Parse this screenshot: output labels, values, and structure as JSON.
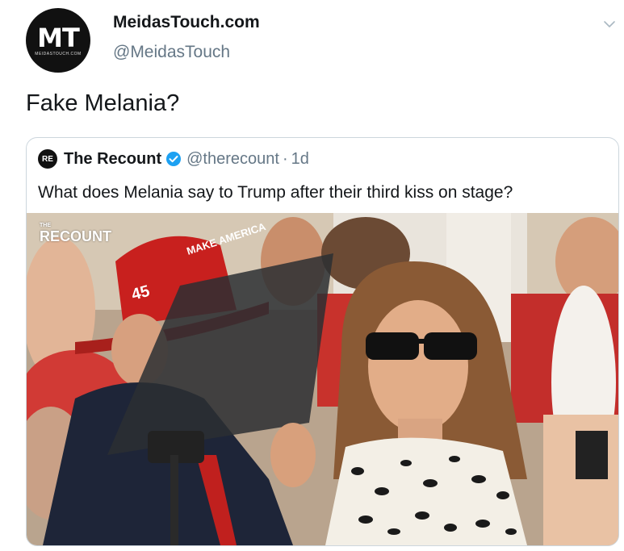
{
  "author": {
    "avatar_text": "MT",
    "avatar_subtext": "MEIDASTOUCH.COM",
    "name": "MeidasTouch.com",
    "handle": "@MeidasTouch"
  },
  "tweet": {
    "text": "Fake Melania?"
  },
  "quoted": {
    "logo_text": "RE",
    "name": "The Recount",
    "handle": "@therecount",
    "separator": "·",
    "time": "1d",
    "text": "What does Melania say to Trump after their third kiss on stage?",
    "media": {
      "watermark_small": "THE",
      "watermark": "RECOUNT",
      "hat_text": "MAKE AMERICA",
      "hat_number": "45"
    }
  },
  "icons": [
    "chevron-down-icon",
    "verified-badge-icon"
  ],
  "colors": {
    "name": "#14171a",
    "secondary": "#657786",
    "verified": "#1da1f2",
    "border": "#ccd6dd"
  }
}
